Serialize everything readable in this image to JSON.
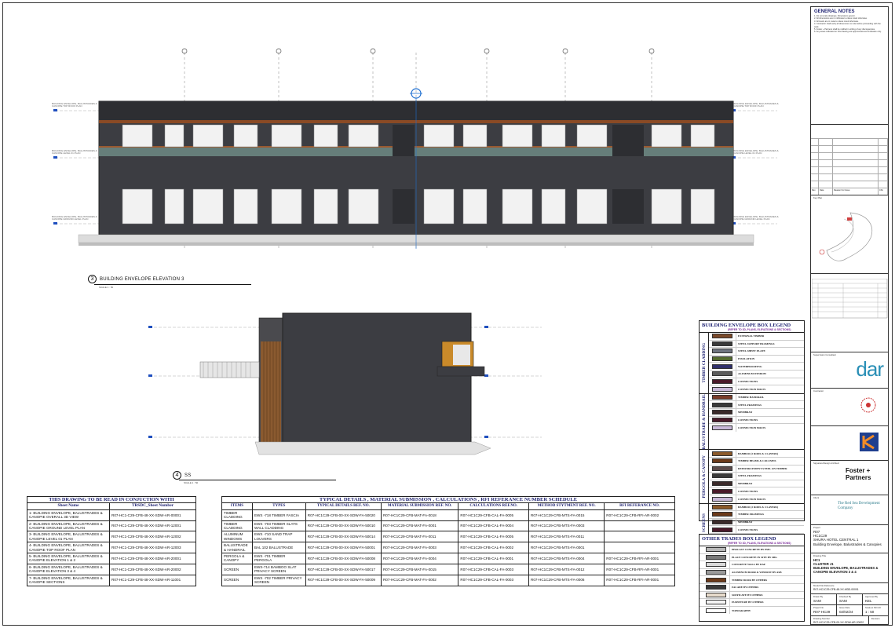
{
  "views": {
    "elevation3": {
      "number": "3",
      "title": "BUILDING ENVELOPE ELEVATION 3",
      "scale": "SCALE 1 : 50"
    },
    "section": {
      "number": "4",
      "title": "SS",
      "scale": "SCALE 1 : 50"
    }
  },
  "level_tags": {
    "roof": "BUILDING ENVELOPE, BALUSTRADES & CANOPIE TOP ROOF PLAN",
    "level1": "BUILDING ENVELOPE, BALUSTRADES & CANOPIE LEVEL 01 PLAN",
    "ground": "BUILDING ENVELOPE, BALUSTRADES & CANOPIE GROUND LEVEL PLAN"
  },
  "conjunction_table": {
    "caption": "THIS DRAWING TO BE READ IN CONJUCTION WITH",
    "headers": [
      "Sheet Name",
      "TRSDC_Sheet Number"
    ],
    "rows": [
      [
        "1- BUILDING ENVELOPE, BALUSTRADES & CANOPIE OVERALL 3D VIEW",
        "R07-HC1-C29-CFB-48-XX-SDW-AR-00001"
      ],
      [
        "2- BUILDING ENVELOPE, BALUSTRADES & CANOPIE GROUND LEVEL PLAN",
        "R07-HC1-C29-CFB-48-XX-SDW-AR-12001"
      ],
      [
        "3- BUILDING ENVELOPE, BALUSTRADES & CANOPIE LEVEL 01 PLAN",
        "R07-HC1-C29-CFB-48-XX-SDW-AR-12002"
      ],
      [
        "4- BUILDING ENVELOPE, BALUSTRADES & CANOPIE TOP ROOF PLAN",
        "R07-HC1-C29-CFB-48-XX-SDW-AR-12003"
      ],
      [
        "5- BUILDING ENVELOPE, BALUSTRADES & CANOPIE ELEVATION 1 & 2",
        "R07-HC1-C29-CFB-48-XX-SDW-AR-20001"
      ],
      [
        "6- BUILDING ENVELOPE, BALUSTRADES & CANOPIE ELEVATION 3 & 4",
        "R07-HC1-C29-CFB-48-XX-SDW-AR-20002"
      ],
      [
        "7- BUILDING ENVELOPE, BALUSTRADES & CANOPIE SECTIONS",
        "R07-HC1-C29-CFB-48-XX-SDW-AR-11001"
      ]
    ]
  },
  "schedule_table": {
    "caption": "TYPICAL DETAILS , MATERIAL SUBMISSION , CALCULATIONS , RFI REFERANCE NUMBER SCHEDULE",
    "headers": [
      "ITEMS",
      "TYPES",
      "TYPICAL DETAILS REF. NO.",
      "MATERIAL SUBMISSION REF. NO.",
      "CALCULATIONS REF.NO.",
      "METHOD STYTMENT REF. NO.",
      "RFI REFERANCE NO."
    ],
    "rows": [
      [
        "TIMBER CLADDING",
        "EWS -718 TIMBER FASCIA",
        "R07-HC1C29-CFB-00-XX-SDW-FA-50020",
        "R07-HC1C29-CFB-MAT-FA-0018",
        "R07-HC1C29-CFB-CAL-FA-0005",
        "R07-HC1C29-CFB-MTS-FA-0015",
        "R07-HC1C29-CFB-RFI-AR-0002"
      ],
      [
        "TIMBER CLADDING",
        "EWS -703 TIMBER SLATS WALL CLADDING",
        "R07-HC1C29-CFB-00-XX-SDW-FA-50010",
        "R07-HC1C29-CFB-MAT-FA-0001",
        "R07-HC1C29-CFB-CAL-FA-0004",
        "R07-HC1C29-CFB-MTS-FA-0003",
        ""
      ],
      [
        "ALUMINUM WINDOWS",
        "EWS -710 SAND TRAP LOUVERS",
        "R07-HC1C29-CFB-00-XX-SDW-FA-50014",
        "R07-HC1C29-CFB-MAT-FA-0011",
        "R07-HC1C29-CFB-CAL-FA-0005",
        "R07-HC1C29-CFB-MTS-FA-0011",
        ""
      ],
      [
        "BALUSTRADE & HANDRAIL",
        "BAL 102 BALUSTRADE",
        "R07-HC1C29-CFB-00-XX-SDW-FA-50001",
        "R07-HC1C29-CFB-MAT-FA-0003",
        "R07-HC1C29-CFB-CAL-FA-0002",
        "R07-HC1C29-CFB-MTS-FA-0001",
        ""
      ],
      [
        "PERGOLA & CANOPY",
        "EWS -701 TIMBER PERGOLA",
        "R07-HC1C29-CFB-00-XX-SDW-FA-50008",
        "R07-HC1C29-CFB-MAT-FA-0004",
        "R07-HC1C29-CFB-CAL-FA-0001",
        "R07-HC1C29-CFB-MTS-FA-0004",
        "R07-HC1C29-CFB-RFI-AR-0001"
      ],
      [
        "SCREEN",
        "EWS-714 BAMBOO SLAT PRIVACY SCREEN",
        "R07-HC1C29-CFB-00-XX-SDW-FA-50017",
        "R07-HC1C29-CFB-MAT-FA-0015",
        "R07-HC1C29-CFB-CAL-FA-0003",
        "R07-HC1C29-CFB-MTS-FA-0012",
        "R07-HC1C29-CFB-RFI-AR-0001"
      ],
      [
        "SCREEN",
        "EWS -702 TIMBER PRIVACY SCREEN",
        "R07-HC1C29-CFB-00-XX-SDW-FA-50009",
        "R07-HC1C29-CFB-MAT-FA-0002",
        "R07-HC1C29-CFB-CAL-FA-0003",
        "R07-HC1C29-CFB-MTS-FA-0006",
        "R07-HC1C29-CFB-RFI-AR-0001"
      ]
    ]
  },
  "envelope_legend": {
    "title": "BUILDING ENVELOPE BOX LEGEND",
    "subtitle": "(REFER TO 3D, PLANS, ELEVATIONS & SECTIONS)",
    "groups": [
      {
        "label": "TIMBER CLADDING",
        "items": [
          {
            "label": "EXTERNAL TIMBER",
            "color": "#7b4a2a"
          },
          {
            "label": "STEEL SUPPORT FRAMINGS",
            "color": "#3a3a3a"
          },
          {
            "label": "STEEL SHEET PLATE",
            "color": "#6f7480"
          },
          {
            "label": "INSULATION",
            "color": "#556b2f"
          },
          {
            "label": "WATERPROOFING",
            "color": "#2f2f6b"
          },
          {
            "label": "ALUMINUM WINDOW",
            "color": "#5a5a5a"
          },
          {
            "label": "CONNECTIONS",
            "color": "#4a1a2a"
          },
          {
            "label": "CONNECTION BOLTS",
            "color": "#c8b8d8"
          }
        ]
      },
      {
        "label": "BALUSTRADE & HANDRAIL",
        "items": [
          {
            "label": "TIMBER HANDRAIL",
            "color": "#7a3d2a"
          },
          {
            "label": "STEEL FRAMINGS",
            "color": "#3a3a3a"
          },
          {
            "label": "MEMBRAN",
            "color": "#3a2a2a"
          },
          {
            "label": "CONNECTIONS",
            "color": "#4a1a2a"
          },
          {
            "label": "CONNECTION BOLTS",
            "color": "#c8b8d8"
          }
        ]
      },
      {
        "label": "PERGOLA & CANOPY",
        "items": [
          {
            "label": "BAMBOO (2 RODS & 4 LAYERS)",
            "color": "#8b5a2b"
          },
          {
            "label": "TIMBER BEAMS & COLUMNS",
            "color": "#6b3a1a"
          },
          {
            "label": "REINFORCEMENT STEEL ON TIMBER",
            "color": "#5a4a4a"
          },
          {
            "label": "STEEL FRAMINGS",
            "color": "#3a3a3a"
          },
          {
            "label": "MEMBRAN",
            "color": "#3a2a2a"
          },
          {
            "label": "CONNECTIONS",
            "color": "#4a1a2a"
          },
          {
            "label": "CONNECTION BOLTS",
            "color": "#c8b8d8"
          }
        ]
      },
      {
        "label": "SCREENS",
        "items": [
          {
            "label": "BAMBOO (2 RODS & 4 LAYERS)",
            "color": "#8b5a2b"
          },
          {
            "label": "TIMBER FRAMINGS",
            "color": "#6b3a1a"
          },
          {
            "label": "MEMBRAN",
            "color": "#3a2a2a"
          },
          {
            "label": "CONNECTIONS",
            "color": "#4a1a2a"
          },
          {
            "label": "CONNECTION BOLTS",
            "color": "#c8b8d8"
          }
        ]
      }
    ]
  },
  "other_trades_legend": {
    "title": "OTHER TRADES BOX LEGEND",
    "subtitle": "(REFER TO 3D, PLANS, ELEVATIONS & SECTIONS)",
    "items": [
      {
        "label": "PERCAST CONCRETE BY PMC",
        "color": "#b8b8b8"
      },
      {
        "label": "PLACE CONCRETE IN SITE BY SBG",
        "color": "#7a7a7a"
      },
      {
        "label": "CONCRETE WALL BY DAF",
        "color": "#d8d8d8"
      },
      {
        "label": "ALUMINUM DOOR & WINDOW BY ASB",
        "color": "#9a9a9a"
      },
      {
        "label": "TIMBER DOOR BY OTHERS",
        "color": "#6b3a1a"
      },
      {
        "label": "FACADE BY OTHERS",
        "color": "#3a3a3a"
      },
      {
        "label": "SOFFICATE BY OTHERS",
        "color": "#e8dccc"
      },
      {
        "label": "FURNITURE BY OTHERS",
        "color": "#f4f4f4"
      },
      {
        "label": "TOPOGRAPHY",
        "color": "#ffffff"
      }
    ]
  },
  "title_block": {
    "general_notes_title": "GENERAL NOTES",
    "general_notes": [
      "1. Do not scale drawings. Dimensions govern.",
      "2. All dimensions are in millimeters unless noted otherwise.",
      "3. All levels are in meters unless noted otherwise.",
      "4. Contractor shall verify all dimensions on site before proceeding with the work.",
      "5. Foster + Partners shall be notified in writing of any discrepancies.",
      "6. Any areas indicated on this drawing are approximate and indicative only."
    ],
    "rev_headers": [
      "Rev",
      "Date",
      "Reason For Issue",
      "Chk"
    ],
    "key_plan_label": "Key Plan",
    "supervision_label": "Supervision Consultant",
    "dar_logo": "dar",
    "contractor_label": "Contractor",
    "architect_label": "Signature/Design Architect",
    "fp_logo": "Foster + Partners",
    "client_label": "Client",
    "client_logo": "The Red Sea Development Company",
    "project_label": "Project",
    "project_lines": [
      "R07",
      "HC1C29",
      "SHURA HOTEL CENTRAL 1",
      "Building Envelope, Balustrades & Canopies"
    ],
    "drawing_title_label": "Drawing Title",
    "drawing_title_lines": [
      "HC1",
      "CLUSTER J1",
      "BUILDING ENVELOPE, BALUSTRADES & CANOPIE ELEVATION 3 & 4"
    ],
    "model_ref_label": "Model File Reference",
    "model_ref": "R07-HC1C29-CFB-48-XX-M3D-00001",
    "drawn_by_label": "Drawn By",
    "drawn_by": "SAM",
    "checked_by_label": "Checked By",
    "checked_by": "SAM",
    "approved_by_label": "Approved By",
    "approved_by": "KEL",
    "project_no_label": "Project No",
    "project_no": "R07-HC29",
    "issue_date_label": "Issue Date",
    "issue_date": "02/02/24",
    "scale_label": "Scale at ISO A0",
    "scale": "1 : 50",
    "drawing_number_label": "Drawing Number",
    "drawing_number": "R07-HC1C29-CFB-00-XX-SDW-AR-20002",
    "revision_label": "Revision"
  }
}
